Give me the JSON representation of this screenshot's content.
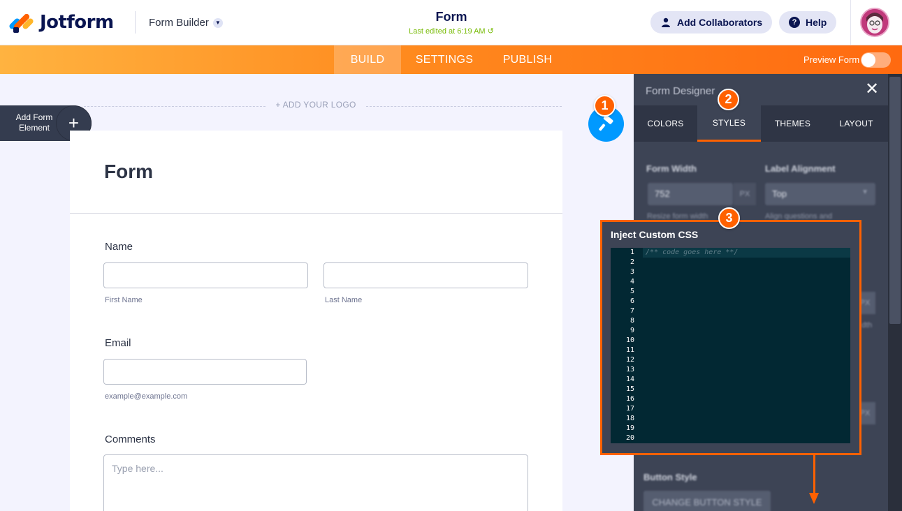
{
  "app": {
    "brand": "Jotform",
    "builder_label": "Form Builder",
    "form_title": "Form",
    "last_edited": "Last edited at 6:19 AM",
    "add_collaborators": "Add Collaborators",
    "help": "Help"
  },
  "nav": {
    "tabs": [
      "BUILD",
      "SETTINGS",
      "PUBLISH"
    ],
    "active": "BUILD",
    "preview_label": "Preview Form",
    "preview_on": false
  },
  "canvas": {
    "add_element_line1": "Add Form",
    "add_element_line2": "Element",
    "add_logo": "+ ADD YOUR LOGO",
    "form_heading": "Form",
    "fields": {
      "name_label": "Name",
      "first_name": "First Name",
      "last_name": "Last Name",
      "email_label": "Email",
      "email_hint": "example@example.com",
      "comments_label": "Comments",
      "comments_placeholder": "Type here..."
    }
  },
  "designer": {
    "title": "Form Designer",
    "tabs": [
      "COLORS",
      "STYLES",
      "THEMES",
      "LAYOUT"
    ],
    "active_tab": "STYLES",
    "form_width_label": "Form Width",
    "form_width_value": "752",
    "form_width_unit": "PX",
    "form_width_hint": "Resize form width",
    "label_alignment_label": "Label Alignment",
    "label_alignment_value": "Top",
    "label_alignment_hint": "Align questions and",
    "frag_unit": "PX",
    "frag_hint": "dth",
    "button_style_label": "Button Style",
    "change_button_style": "CHANGE BUTTON STYLE"
  },
  "css_editor": {
    "title": "Inject Custom CSS",
    "placeholder_code": "/** code goes here **/",
    "line_numbers": [
      "1",
      "2",
      "3",
      "4",
      "5",
      "6",
      "7",
      "8",
      "9",
      "10",
      "11",
      "12",
      "13",
      "14",
      "15",
      "16",
      "17",
      "18",
      "19",
      "20"
    ]
  },
  "callouts": {
    "one": "1",
    "two": "2",
    "three": "3"
  },
  "colors": {
    "accent_orange": "#ff6100",
    "brand_navy": "#0a1551",
    "designer_blue": "#0099ff",
    "edited_green": "#78bb07"
  }
}
